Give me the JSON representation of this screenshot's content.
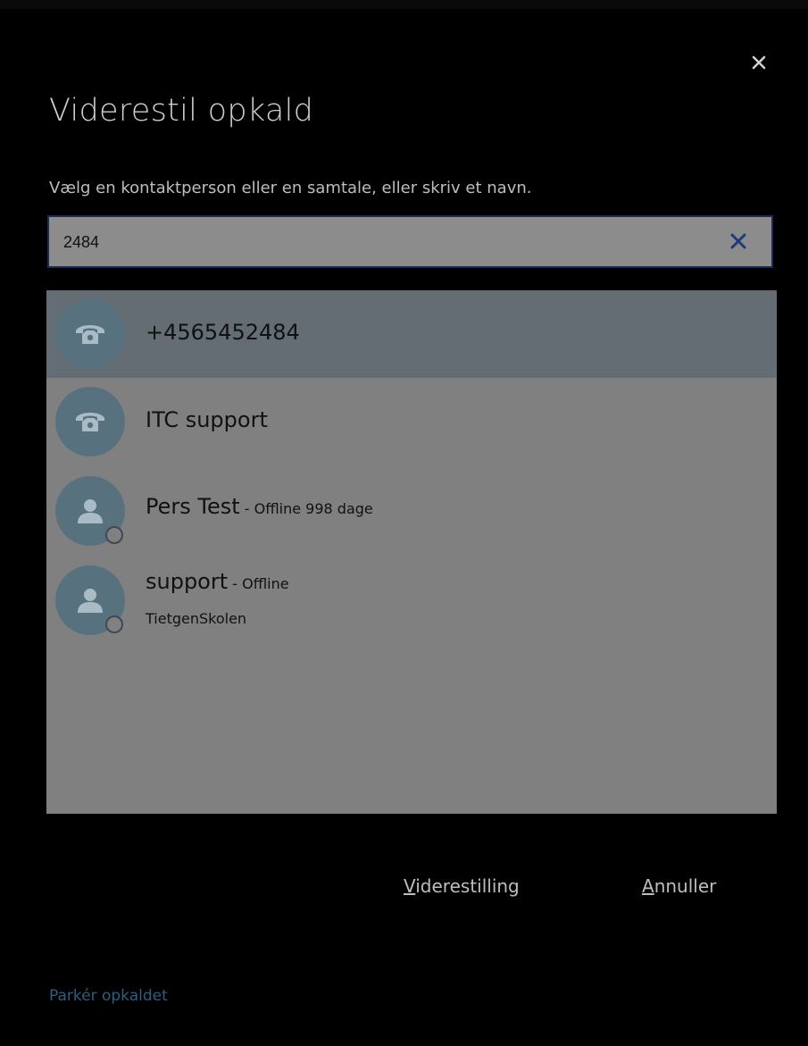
{
  "dialog": {
    "title": "Viderestil opkald",
    "instruction": "Vælg en kontaktperson eller en samtale, eller skriv et navn."
  },
  "search": {
    "value": "2484"
  },
  "results": [
    {
      "name": "+4565452484",
      "status": "",
      "sub": "",
      "type": "phone",
      "selected": true
    },
    {
      "name": "ITC support",
      "status": "",
      "sub": "",
      "type": "phone",
      "selected": false
    },
    {
      "name": "Pers Test",
      "status": " - Offline 998 dage",
      "sub": "",
      "type": "person",
      "selected": false
    },
    {
      "name": "support",
      "status": " - Offline",
      "sub": "TietgenSkolen",
      "type": "person",
      "selected": false
    }
  ],
  "actions": {
    "transfer_mnemonic": "V",
    "transfer_rest": "iderestilling",
    "cancel_mnemonic": "A",
    "cancel_rest": "nnuller"
  },
  "footer": {
    "park_label": "Parkér opkaldet"
  },
  "colors": {
    "background": "#000000",
    "list_background": "#808080",
    "selected_row": "#646d74",
    "avatar": "#57717e",
    "clear_icon": "#1f3a7a",
    "link": "#2d5f80"
  },
  "icons": {
    "close": "close-icon",
    "clear": "clear-search-icon",
    "phone": "phone-icon",
    "person": "person-icon"
  }
}
